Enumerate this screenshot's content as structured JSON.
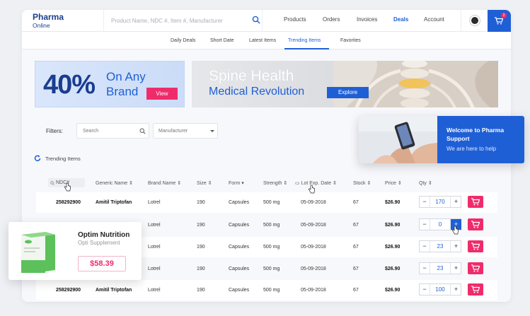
{
  "brand": {
    "line1": "Pharma",
    "line2": "Online"
  },
  "search": {
    "placeholder": "Product Name, NDC #, Item #, Manufacturer"
  },
  "nav": [
    "Products",
    "Orders",
    "Invoices",
    "Deals",
    "Account"
  ],
  "nav_active": "Deals",
  "cart_badge": "2",
  "tabs": [
    "Daily Deals",
    "Short Date",
    "Latest Items",
    "Trending Items",
    "Favorites"
  ],
  "tab_active": "Trending Items",
  "banner1": {
    "big": "40%",
    "line1": "On Any",
    "line2": "Brand",
    "button": "View"
  },
  "banner2": {
    "line1": "Spine Health",
    "line2": "Medical Revolution",
    "button": "Explore"
  },
  "filters": {
    "label": "Filters:",
    "search_placeholder": "Search",
    "manufacturer_placeholder": "Manufacturer"
  },
  "section_title": "Trending Items",
  "table": {
    "headers": [
      "NDC#",
      "Generic Name",
      "Brand Name",
      "Size",
      "Form",
      "Strength",
      "Lot Exp. Date",
      "Stock",
      "Price",
      "Qty"
    ],
    "rows": [
      {
        "ndc": "258292900",
        "generic": "Amitil Triptofan",
        "brand": "Lotrel",
        "size": "190",
        "form": "Capsules",
        "strength": "500 mg",
        "exp": "05-09-2018",
        "stock": "67",
        "price": "$26.90",
        "qty": "170"
      },
      {
        "ndc": "",
        "generic": "",
        "brand": "Lotrel",
        "size": "190",
        "form": "Capsules",
        "strength": "500 mg",
        "exp": "05-09-2018",
        "stock": "67",
        "price": "$26.90",
        "qty": "0"
      },
      {
        "ndc": "",
        "generic": "",
        "brand": "Lotrel",
        "size": "190",
        "form": "Capsules",
        "strength": "500 mg",
        "exp": "05-09-2018",
        "stock": "67",
        "price": "$26.90",
        "qty": "23"
      },
      {
        "ndc": "",
        "generic": "",
        "brand": "Lotrel",
        "size": "190",
        "form": "Capsules",
        "strength": "500 mg",
        "exp": "05-09-2018",
        "stock": "67",
        "price": "$26.90",
        "qty": "23"
      },
      {
        "ndc": "258292900",
        "generic": "Amitil Triptofan",
        "brand": "Lotrel",
        "size": "190",
        "form": "Capsules",
        "strength": "500 mg",
        "exp": "05-09-2018",
        "stock": "67",
        "price": "$26.90",
        "qty": "100"
      }
    ]
  },
  "product_card": {
    "name": "Optim Nutrition",
    "subtitle": "Opti Supplement",
    "price": "$58.39"
  },
  "support_card": {
    "title": "Welcome to Pharma Support",
    "subtitle": "We are here to help"
  },
  "colors": {
    "primary": "#1f5fd6",
    "accent": "#ef2c6b",
    "navy": "#1a3d8f"
  }
}
